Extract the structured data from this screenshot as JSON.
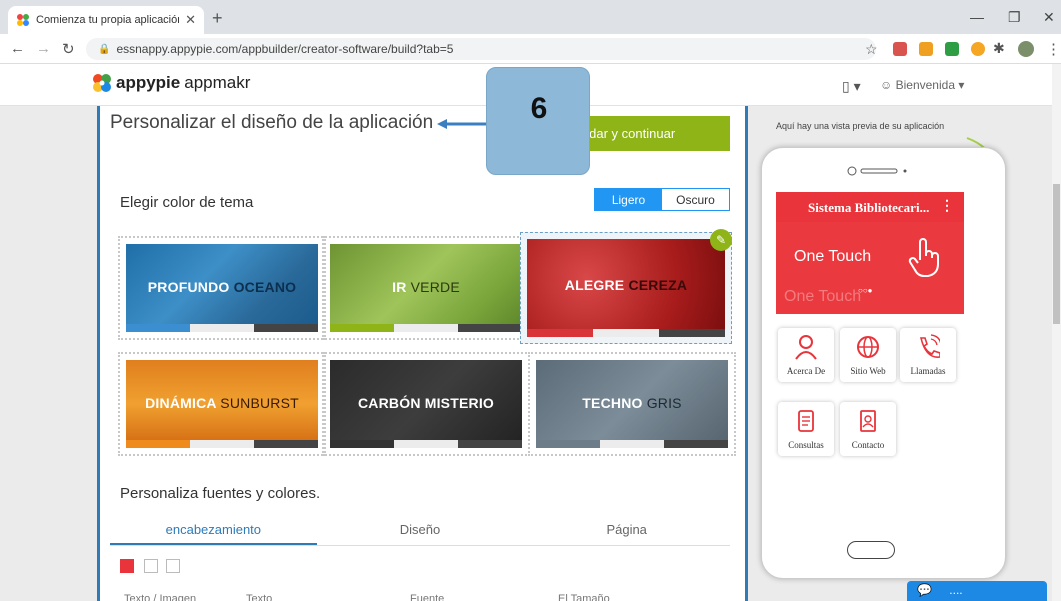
{
  "browser": {
    "tab_title": "Comienza tu propia aplicación e",
    "url": "essnappy.appypie.com/appbuilder/creator-software/build?tab=5"
  },
  "header": {
    "brand": "appypie",
    "product": "appmakr",
    "welcome": "Bienvenida"
  },
  "main": {
    "title": "Personalizar el diseño de la aplicación",
    "save_button": "rdar y continuar",
    "step_number": "6",
    "choose_theme_label": "Elegir color de tema",
    "mode_light": "Ligero",
    "mode_dark": "Oscuro",
    "themes": [
      {
        "word1": "PROFUNDO",
        "word2": "OCEANO",
        "selected": false
      },
      {
        "word1": "IR",
        "word2": "VERDE",
        "selected": false
      },
      {
        "word1": "ALEGRE",
        "word2": "CEREZA",
        "selected": true
      },
      {
        "word1": "DINÁMICA",
        "word2": "SUNBURST",
        "selected": false
      },
      {
        "word1": "CARBÓN",
        "word2": "MISTERIO",
        "selected": false
      },
      {
        "word1": "TECHNO",
        "word2": "GRIS",
        "selected": false
      }
    ],
    "fonts_label": "Personaliza fuentes y colores.",
    "font_tabs": [
      "encabezamiento",
      "Diseño",
      "Página"
    ],
    "columns": [
      "Texto / Imagen",
      "Texto",
      "Fuente",
      "El Tamaño"
    ]
  },
  "preview": {
    "label": "Aquí hay una vista previa de su aplicación",
    "app_title": "Sistema Bibliotecari...",
    "banner_text": "One Touch",
    "banner_text_ghost": "One Touch",
    "icons": [
      "Acerca De",
      "Sitio Web",
      "Llamadas",
      "Consultas",
      "Contacto"
    ]
  },
  "chat": {
    "label": "...."
  },
  "colors": {
    "accent_blue": "#2e7bb8",
    "save_green": "#8fb418",
    "app_red": "#e8343a"
  }
}
